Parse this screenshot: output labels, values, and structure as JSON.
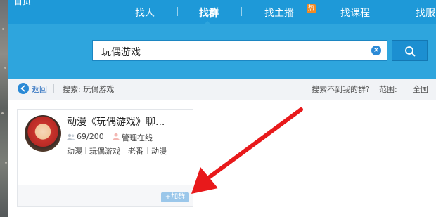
{
  "nav": {
    "logo_label": "首页",
    "items": [
      {
        "label": "找人"
      },
      {
        "label": "找群"
      },
      {
        "label": "找主播"
      },
      {
        "label": "找课程"
      },
      {
        "label": "找服"
      }
    ],
    "hot_badge": "热"
  },
  "search": {
    "query": "玩偶游戏",
    "clear_icon": "clear-circle-icon",
    "button_icon": "search-icon"
  },
  "breadcrumb": {
    "back": "返回",
    "search_label": "搜索: 玩偶游戏",
    "not_found": "搜索不到我的群?",
    "range_label": "范围:",
    "range_value": "全国"
  },
  "results": [
    {
      "title": "动漫《玩偶游戏》聊...",
      "members": "69/200",
      "admin_status": "管理在线",
      "tags": [
        "动漫",
        "玩偶游戏",
        "老番",
        "动漫"
      ],
      "join_label": "+加群"
    }
  ],
  "colors": {
    "nav_bg": "#1e99d8",
    "search_band_bg": "#2ea5dd",
    "accent": "#2b8ad6",
    "arrow": "#e8191b"
  }
}
